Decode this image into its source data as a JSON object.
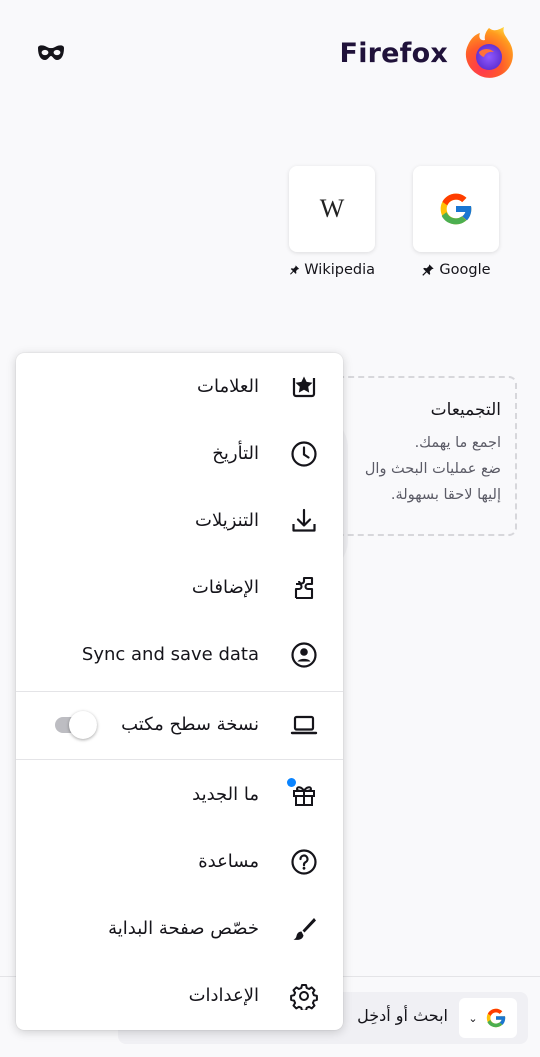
{
  "header": {
    "brand": "Firefox",
    "private_icon": "private-mask-icon",
    "logo_icon": "firefox-logo-icon"
  },
  "top_sites": [
    {
      "label": "Google",
      "pinned": true,
      "icon": "google-g-icon"
    },
    {
      "label": "Wikipedia",
      "pinned": true,
      "icon": "wikipedia-w-icon"
    }
  ],
  "collections": {
    "title": "التجميعات",
    "lines": [
      "اجمع ما يهمك.",
      "ضع عمليات البحث وال",
      "إليها لاحقا بسهولة."
    ]
  },
  "menu": {
    "items": [
      {
        "label": "العلامات",
        "icon": "bookmark-star-icon"
      },
      {
        "label": "التأريخ",
        "icon": "clock-history-icon"
      },
      {
        "label": "التنزيلات",
        "icon": "download-icon"
      },
      {
        "label": "الإضافات",
        "icon": "puzzle-addons-icon"
      },
      {
        "label": "Sync and save data",
        "icon": "account-icon"
      },
      {
        "label": "نسخة سطح مكتب",
        "icon": "laptop-icon",
        "toggle_on": false
      },
      {
        "label": "ما الجديد",
        "icon": "gift-icon",
        "badge_color": "#0a84ff"
      },
      {
        "label": "مساعدة",
        "icon": "help-question-icon"
      },
      {
        "label": "خصّص صفحة البداية",
        "icon": "paintbrush-icon"
      },
      {
        "label": "الإعدادات",
        "icon": "gear-icon"
      }
    ]
  },
  "toolbar": {
    "search_placeholder": "ابحث أو أدخِل",
    "engine_icon": "google-g-icon"
  },
  "colors": {
    "background": "#f9f9fb",
    "accent": "#0a84ff",
    "brand_text": "#20123a"
  }
}
